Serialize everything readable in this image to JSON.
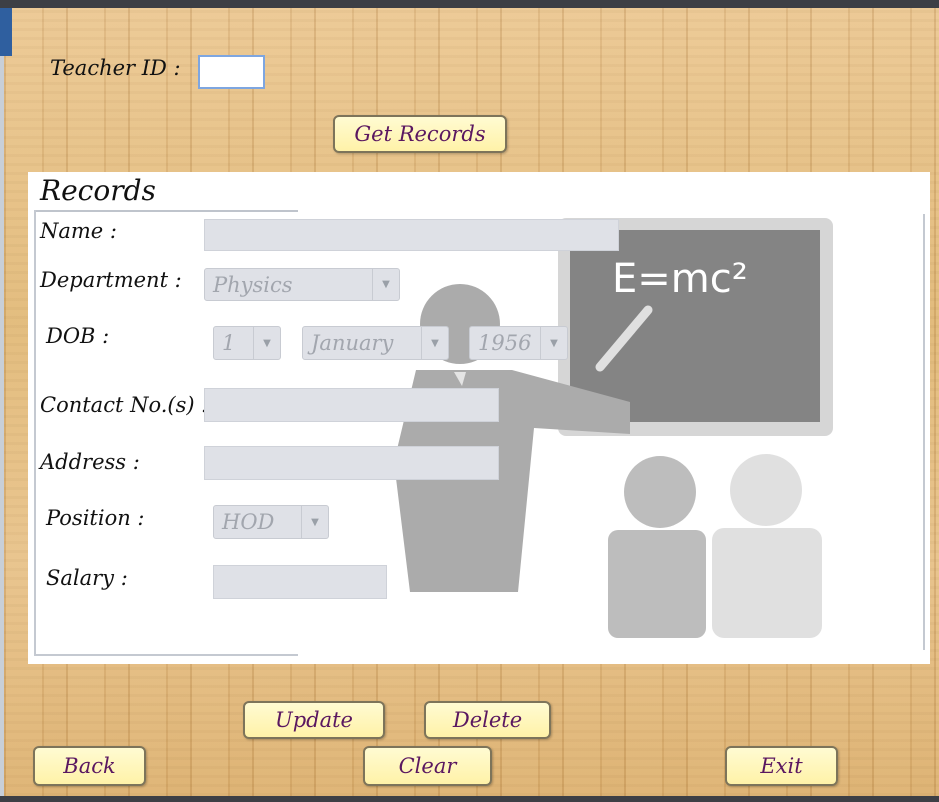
{
  "header": {
    "teacher_id_label": "Teacher ID :",
    "teacher_id_value": "",
    "get_records_label": "Get Records"
  },
  "records": {
    "title": "Records",
    "name_label": "Name :",
    "name_value": "",
    "department_label": "Department :",
    "department_value": "Physics",
    "dob_label": "DOB :",
    "dob_day": "1",
    "dob_month": "January",
    "dob_year": "1956",
    "contact_label": "Contact No.(s) :",
    "contact_value": "",
    "address_label": "Address :",
    "address_value": "",
    "position_label": "Position :",
    "position_value": "HOD",
    "salary_label": "Salary :",
    "salary_value": ""
  },
  "illustration": {
    "board_text": "E=mc²"
  },
  "actions": {
    "update_label": "Update",
    "delete_label": "Delete",
    "back_label": "Back",
    "clear_label": "Clear",
    "exit_label": "Exit"
  },
  "colors": {
    "button_text": "#5a1760",
    "button_fill": "#fff2a8",
    "field_fill": "#dfe1e7",
    "wood": "#e3be86"
  }
}
